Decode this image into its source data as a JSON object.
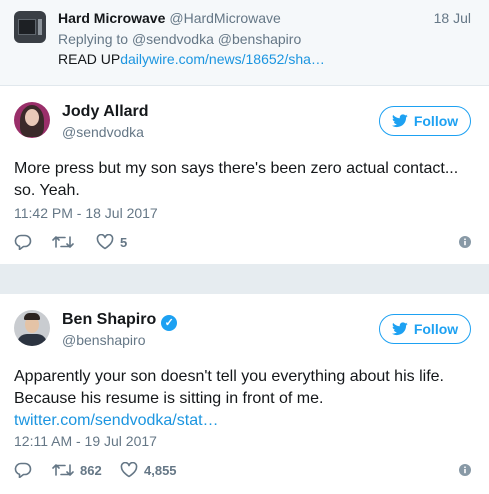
{
  "parent_tweet": {
    "name": "Hard Microwave",
    "handle": "@HardMicrowave",
    "date": "18 Jul",
    "reply_prefix": "Replying to",
    "reply_to": "@sendvodka @benshapiro",
    "text": "READ UP",
    "link": "dailywire.com/news/18652/sha…"
  },
  "tweets": [
    {
      "name": "Jody Allard",
      "handle": "@sendvodka",
      "follow_label": "Follow",
      "text": "More press but my son says there's been zero actual contact... so. Yeah.",
      "link": "",
      "timestamp": "11:42 PM - 18 Jul 2017",
      "retweets": "",
      "likes": "5",
      "verified": false
    },
    {
      "name": "Ben Shapiro",
      "handle": "@benshapiro",
      "follow_label": "Follow",
      "text": "Apparently your son doesn't tell you everything about his life. Because his resume is sitting in front of me.",
      "link": "twitter.com/sendvodka/stat…",
      "timestamp": "12:11 AM - 19 Jul 2017",
      "retweets": "862",
      "likes": "4,855",
      "verified": true
    }
  ],
  "icons": {
    "reply": "reply-icon",
    "retweet": "retweet-icon",
    "like": "heart-icon",
    "more": "info-icon",
    "follow": "twitter-bird-icon",
    "verified": "verified-badge-icon"
  },
  "colors": {
    "accent": "#1da1f2",
    "link": "#1b95e0",
    "secondary_text": "#657786",
    "background": "#e6ecf0"
  }
}
